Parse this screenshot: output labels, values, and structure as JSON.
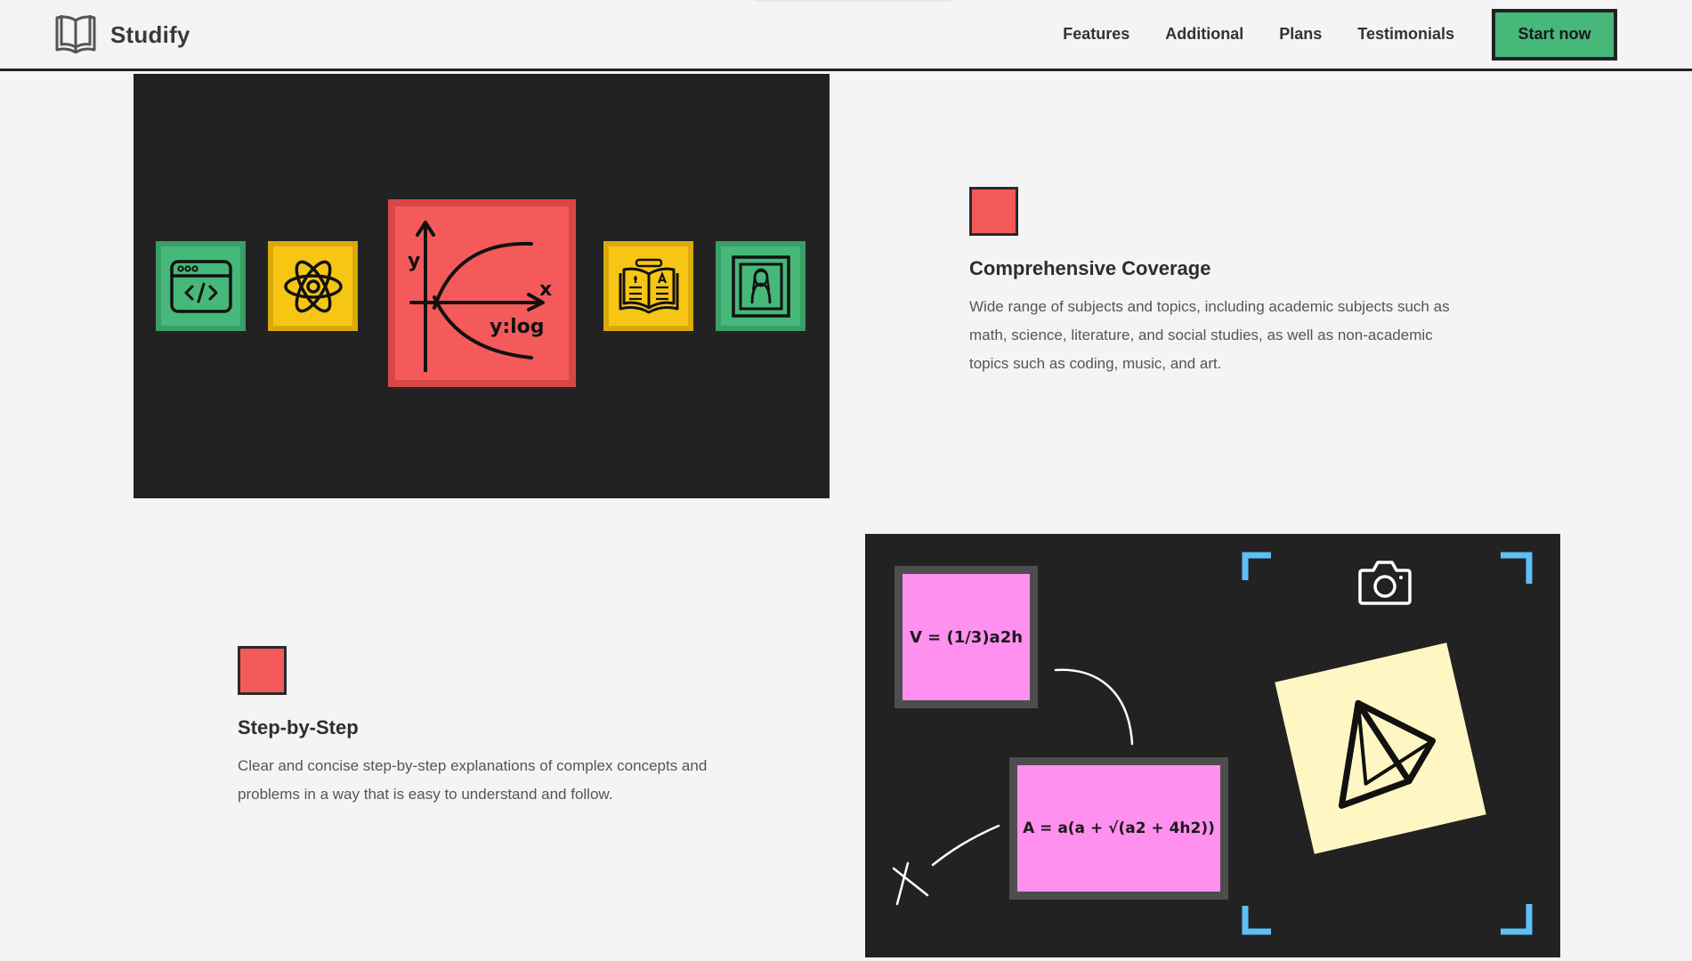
{
  "header": {
    "brand": "Studify",
    "nav": [
      "Features",
      "Additional",
      "Plans",
      "Testimonials"
    ],
    "cta_label": "Start now"
  },
  "section_coverage": {
    "title": "Comprehensive Coverage",
    "description": "Wide range of subjects and topics, including academic subjects such as math, science, literature, and social studies, as well as non-academic topics such as coding, music, and art.",
    "graph_label": "y:log",
    "axis_x": "x",
    "axis_y": "y",
    "icons": [
      "code-window-icon",
      "atom-icon",
      "log-graph-icon",
      "book-icon",
      "portrait-frame-icon"
    ]
  },
  "section_steps": {
    "title": "Step-by-Step",
    "description": "Clear and concise step-by-step explanations of complex concepts and problems in a way that is easy to understand and follow.",
    "formula_1": "V = (1/3)a2h",
    "formula_2": "A = a(a + √(a2 + 4h2))"
  },
  "colors": {
    "accent_green": "#46b87a",
    "accent_red": "#f55a5a",
    "accent_yellow": "#f7c614",
    "accent_pink": "#ff90ef",
    "viewfinder_blue": "#5cc0f5",
    "panel_dark": "#222222"
  }
}
